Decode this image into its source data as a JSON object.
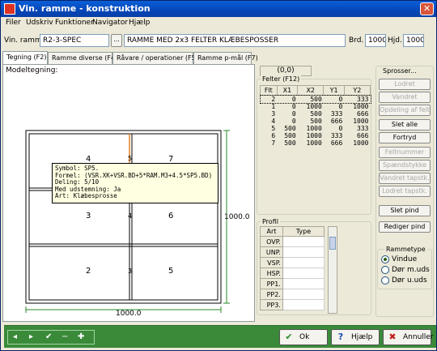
{
  "window": {
    "title": "Vin. ramme - konstruktion",
    "close_glyph": "✕"
  },
  "menu": [
    "Filer",
    "Udskriv",
    "Funktioner",
    "Navigator",
    "Hjælp"
  ],
  "header": {
    "vin_ramme_label": "Vin. ramme",
    "code": "R2-3-SPEC",
    "browse_label": "...",
    "description": "RAMME MED 2x3 FELTER KLÆBESPOSSER",
    "brd_label": "Brd.",
    "brd_value": "1000",
    "hjd_label": "Hjd.",
    "hjd_value": "1000"
  },
  "tabs": [
    "Tegning (F2)",
    "Ramme diverse (F4)",
    "Råvare / operationer (F5)",
    "Ramme p-mål (F7)"
  ],
  "drawing": {
    "label": "Modeltegning:",
    "width_label": "1000.0",
    "height_label": "1000.0",
    "cells": [
      "4",
      "5",
      "7",
      "3",
      "4",
      "6",
      "2",
      "3",
      "5"
    ],
    "tooltip": "Symbol: SP5.\nFormel: (VSR.XK+VSR.BD+5*RAM.M3+4.5*SP5.BD)\nDeling: 5/10\nMed udstemning: Ja\nArt: Klæbesprosse"
  },
  "coords": "(0,0)",
  "felter": {
    "title": "Felter (F12)",
    "columns": [
      "Flt",
      "X1",
      "X2",
      "Y1",
      "Y2"
    ],
    "rows": [
      [
        "2",
        "0",
        "500",
        "0",
        "333"
      ],
      [
        "1",
        "0",
        "1000",
        "0",
        "1000"
      ],
      [
        "3",
        "0",
        "500",
        "333",
        "666"
      ],
      [
        "4",
        "0",
        "500",
        "666",
        "1000"
      ],
      [
        "5",
        "500",
        "1000",
        "0",
        "333"
      ],
      [
        "6",
        "500",
        "1000",
        "333",
        "666"
      ],
      [
        "7",
        "500",
        "1000",
        "666",
        "1000"
      ]
    ]
  },
  "profil": {
    "title": "Profil",
    "columns": [
      "Art",
      "Type"
    ],
    "rows": [
      "OVP.",
      "UNP.",
      "VSP.",
      "HSP.",
      "PP1.",
      "PP2.",
      "PP3."
    ]
  },
  "sprosser": {
    "title": "Sprosser...",
    "buttons": [
      {
        "label": "Lodret",
        "enabled": false
      },
      {
        "label": "Vandret",
        "enabled": false
      },
      {
        "label": "Opdeling af felt",
        "enabled": false
      },
      {
        "label": "Slet alle",
        "enabled": true
      },
      {
        "label": "Fortryd",
        "enabled": true
      },
      {
        "label": "Feltnummer",
        "enabled": false
      },
      {
        "label": "Spændstykke",
        "enabled": false
      },
      {
        "label": "Vandret tapstk.",
        "enabled": false
      },
      {
        "label": "Lodret tapstk.",
        "enabled": false
      },
      {
        "label": "Slet pind",
        "enabled": true
      },
      {
        "label": "Rediger pind",
        "enabled": true
      }
    ]
  },
  "rammetype": {
    "title": "Rammetype",
    "options": [
      "Vindue",
      "Dør m.uds",
      "Dør u.uds"
    ],
    "selected": "Vindue"
  },
  "nav": {
    "glyphs": [
      "◂",
      "▸",
      "✔",
      "−",
      "✚"
    ]
  },
  "actions": {
    "ok": "Ok",
    "help": "Hjælp",
    "cancel": "Annuller"
  },
  "colors": {
    "titlebar": "#0a5fd8",
    "bottombar": "#3a8a3a",
    "tooltip": "#ffffe1",
    "sprosse_highlight": "#e08020"
  }
}
